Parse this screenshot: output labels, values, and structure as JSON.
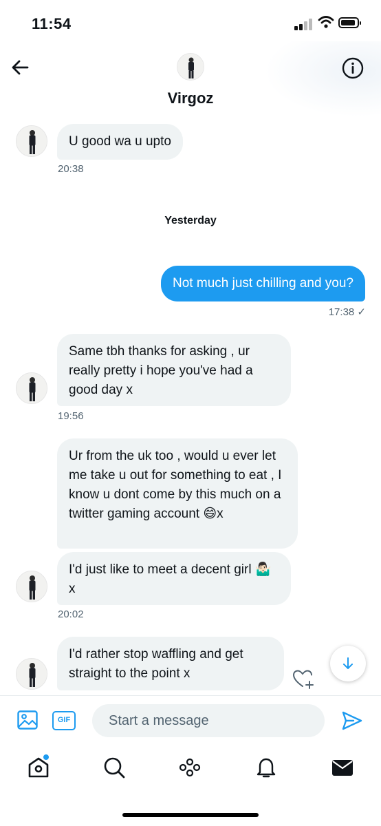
{
  "status_bar": {
    "time": "11:54"
  },
  "header": {
    "name": "Virgoz"
  },
  "messages": [
    {
      "text": "U good wa u upto",
      "time": "20:38"
    },
    {
      "divider": "Yesterday"
    },
    {
      "text": "Not much just chilling and you?",
      "time": "17:38 ✓"
    },
    {
      "text": "Same tbh thanks for asking , ur really pretty i hope you've had a good day x",
      "time": "19:56"
    },
    {
      "text": "Ur from the uk too , would u ever let me take u out for something to eat , I know u dont come by this much on a twitter gaming account 😄x"
    },
    {
      "text": "I'd just like to meet a decent girl 🤷🏻‍♂️ x",
      "time": "20:02"
    },
    {
      "text": "I'd rather stop waffling and get straight to the point x"
    }
  ],
  "composer": {
    "placeholder": "Start a message",
    "gif_label": "GIF"
  },
  "colors": {
    "accent": "#1d9bf0",
    "incoming_bubble": "#eff3f4",
    "text": "#0f1419",
    "muted": "#536471"
  },
  "icons": [
    "back-arrow-icon",
    "info-icon",
    "image-icon",
    "gif-icon",
    "send-icon",
    "arrow-down-icon",
    "heart-plus-icon",
    "home-icon",
    "search-icon",
    "spaces-icon",
    "bell-icon",
    "mail-icon"
  ]
}
